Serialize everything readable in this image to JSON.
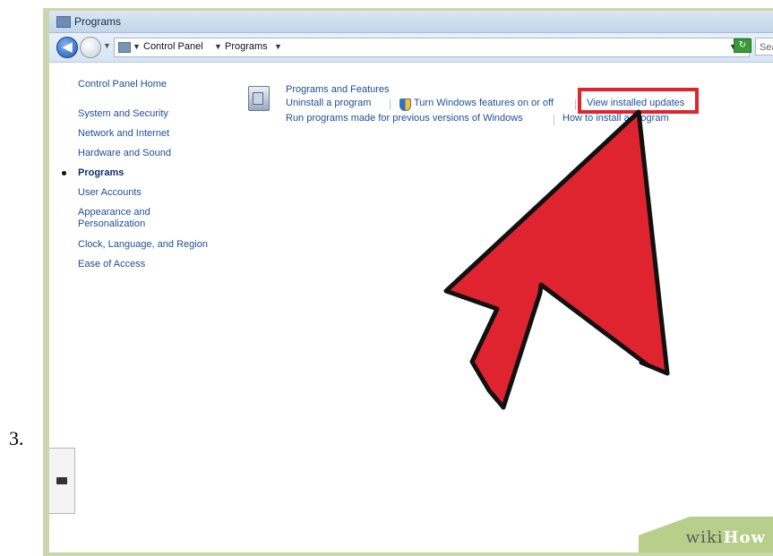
{
  "step_number": "3.",
  "window": {
    "title": "Programs",
    "breadcrumb": [
      "Control Panel",
      "Programs"
    ],
    "search_placeholder": "Sea",
    "icons": {
      "back": "back-arrow-icon",
      "forward": "forward-arrow-icon",
      "refresh": "refresh-icon"
    }
  },
  "sidebar": {
    "items": [
      "Control Panel Home",
      "System and Security",
      "Network and Internet",
      "Hardware and Sound",
      "Programs",
      "User Accounts",
      "Appearance and Personalization",
      "Clock, Language, and Region",
      "Ease of Access"
    ],
    "active_item": "Programs"
  },
  "programs_section": {
    "heading": "Programs and Features",
    "links_row1": [
      "Uninstall a program",
      "Turn Windows features on or off",
      "View installed updates"
    ],
    "links_row2": [
      "Run programs made for previous versions of Windows",
      "How to install a program"
    ],
    "highlighted_link": "View installed updates"
  },
  "watermark": {
    "wiki": "wiki",
    "how": "How"
  },
  "colors": {
    "highlight": "#e0242f",
    "arrow": "#e0242f",
    "link": "#1e4e99"
  }
}
